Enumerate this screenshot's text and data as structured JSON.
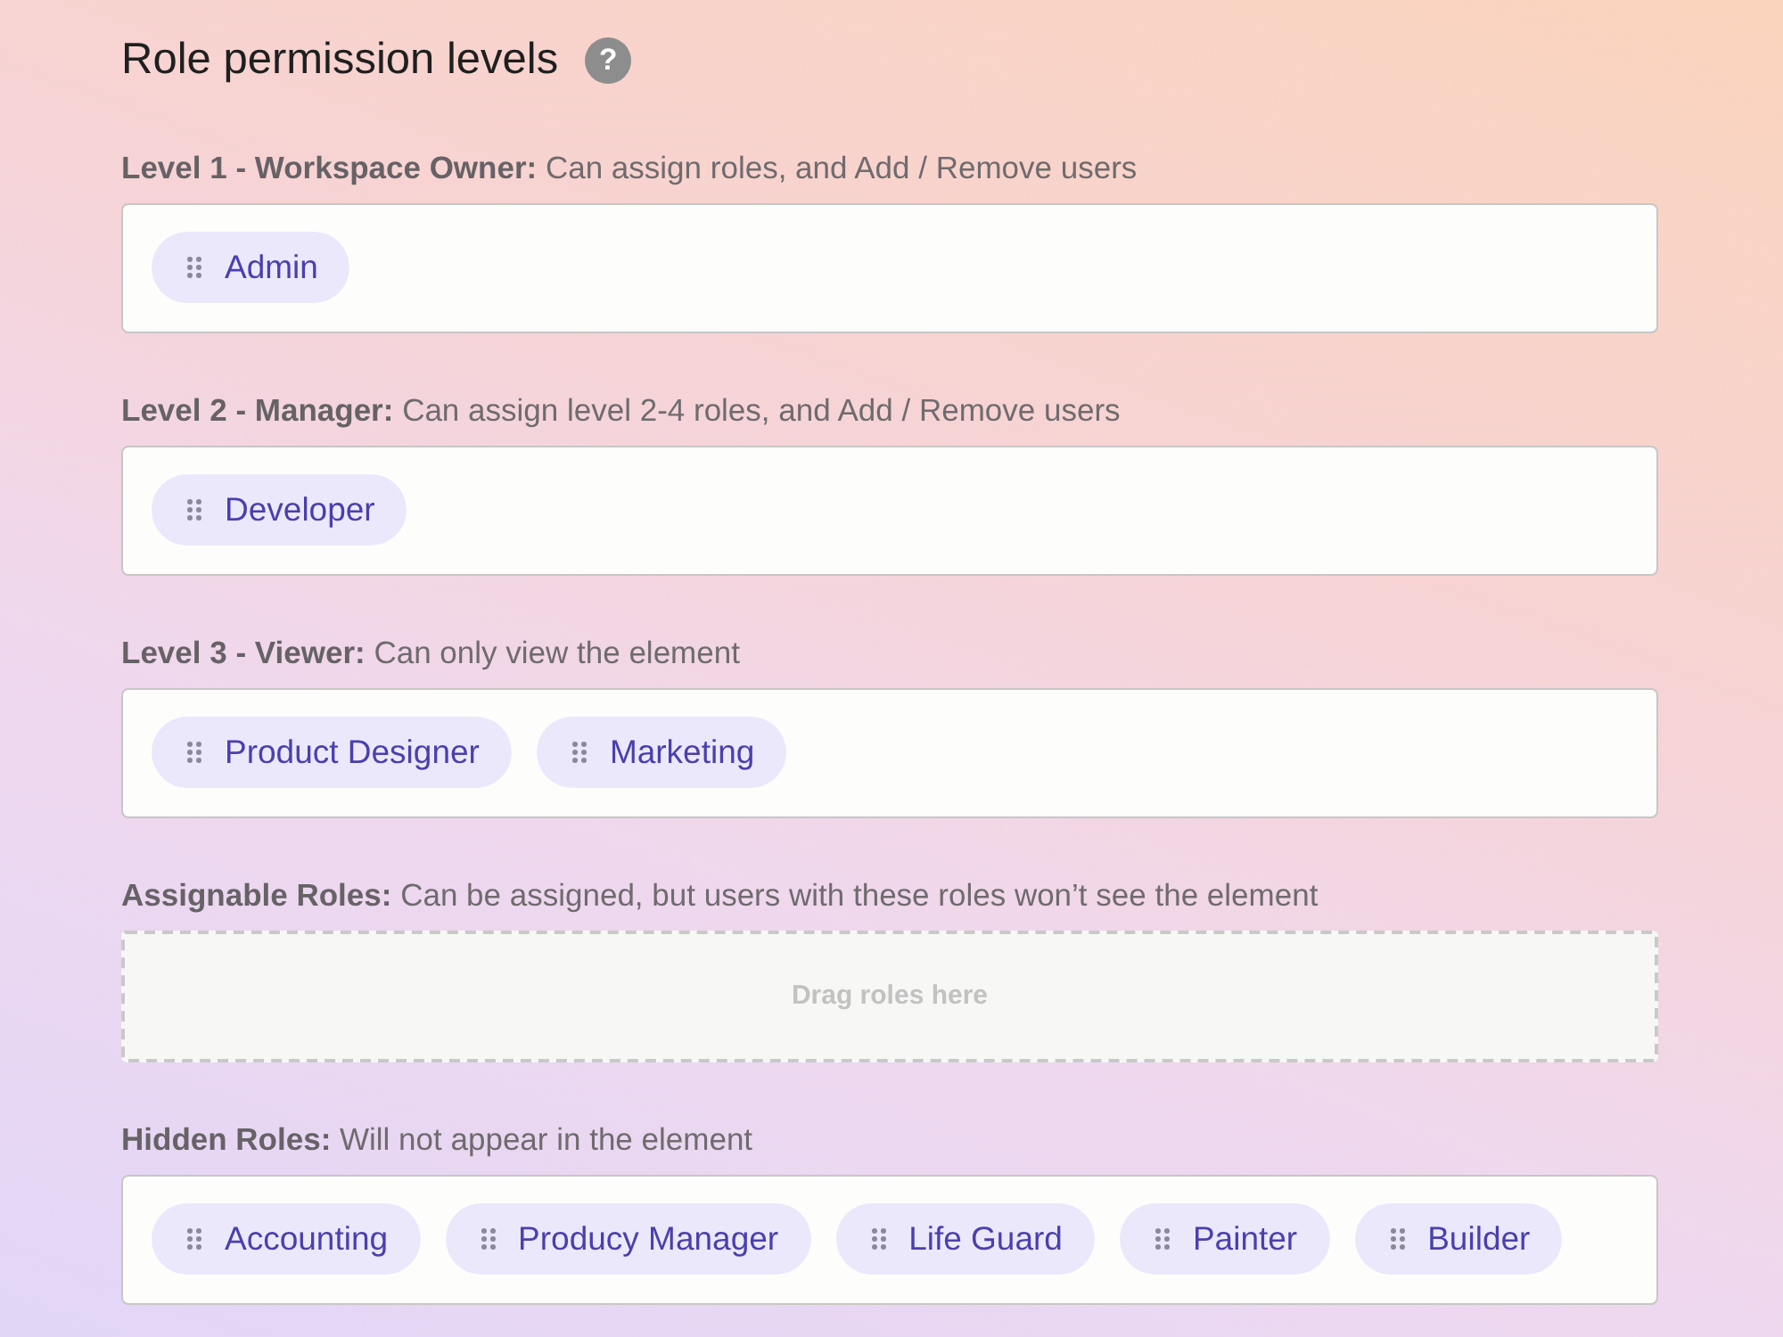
{
  "title": "Role permission levels",
  "help_icon": "?",
  "sections": [
    {
      "kind": "roles",
      "label": "**Level 1 - Workspace Owner:** Can assign roles, and Add / Remove users",
      "roles": [
        "Admin"
      ]
    },
    {
      "kind": "roles",
      "label": "**Level 2 - Manager:** Can assign level 2-4 roles, and Add / Remove users",
      "roles": [
        "Developer"
      ]
    },
    {
      "kind": "roles",
      "label": "**Level 3 - Viewer:** Can only view the element",
      "roles": [
        "Product Designer",
        "Marketing"
      ]
    },
    {
      "kind": "dropzone",
      "label": "**Assignable Roles:** Can be assigned, but users with these roles won’t see the element",
      "placeholder": "Drag roles here"
    },
    {
      "kind": "roles",
      "label": "**Hidden Roles:** Will not appear in the element",
      "roles": [
        "Accounting",
        "Producy Manager",
        "Life Guard",
        "Painter",
        "Builder"
      ]
    }
  ]
}
